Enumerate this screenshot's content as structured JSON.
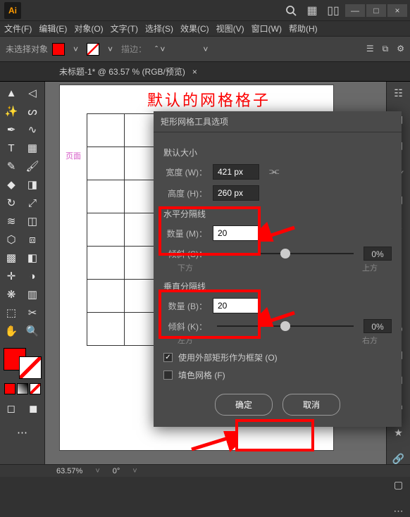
{
  "app": {
    "logo": "Ai"
  },
  "menu": {
    "file": "文件(F)",
    "edit": "编辑(E)",
    "object": "对象(O)",
    "type": "文字(T)",
    "select": "选择(S)",
    "effect": "效果(C)",
    "view": "视图(V)",
    "window": "窗口(W)",
    "help": "帮助(H)"
  },
  "ctrl": {
    "selstatus": "未选择对象",
    "stroke_lbl": "描边：",
    "arrow": "˅"
  },
  "doc": {
    "tab": "未标题-1* @ 63.57 % (RGB/预览)",
    "close": "×"
  },
  "annot": {
    "headline": "默认的网格格子",
    "page": "页面"
  },
  "status": {
    "zoom": "63.57%",
    "angle": "0°"
  },
  "dialog": {
    "title": "矩形网格工具选项",
    "size_head": "默认大小",
    "width_lbl": "宽度 (W)：",
    "width_val": "421 px",
    "height_lbl": "高度 (H)：",
    "height_val": "260 px",
    "hdiv_head": "水平分隔线",
    "count_m_lbl": "数量 (M)：",
    "count_m_val": "20",
    "skew_s_lbl": "倾斜 (S)：",
    "skew_s_pct": "0%",
    "skew_s_left": "下方",
    "skew_s_right": "上方",
    "vdiv_head": "垂直分隔线",
    "count_b_lbl": "数量 (B)：",
    "count_b_val": "20",
    "skew_k_lbl": "倾斜 (K)：",
    "skew_k_pct": "0%",
    "skew_k_left": "左方",
    "skew_k_right": "右方",
    "cb_outer": "使用外部矩形作为框架 (O)",
    "cb_fill": "填色网格 (F)",
    "ok": "确定",
    "cancel": "取消"
  },
  "chart_data": {
    "type": "table",
    "rows": 7,
    "cols": 3,
    "note": "empty grid preview"
  }
}
